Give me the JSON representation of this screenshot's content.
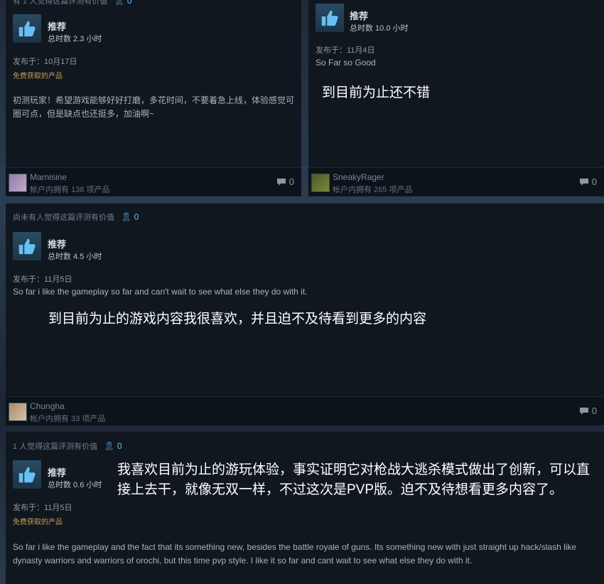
{
  "reviews": [
    {
      "helpful": "有 1 人觉得这篇评测有价值",
      "award_count": "0",
      "recommended": "推荐",
      "hours": "总时数 2.3 小时",
      "posted": "发布于：10月17日",
      "free": "免费获取的产品",
      "body": "初测玩家！希望游戏能够好好打磨，多花时间，不要着急上线，体验感觉可圈可点，但是缺点也还挺多，加油啊~",
      "user": "Marnisine",
      "products": "帐户内拥有 138 项产品",
      "comments": "0"
    },
    {
      "recommended": "推荐",
      "hours": "总时数 10.0 小时",
      "posted": "发布于：11月4日",
      "body": "So Far so Good",
      "overlay": "到目前为止还不错",
      "user": "SneakyRager",
      "products": "帐户内拥有 265 项产品",
      "comments": "0"
    },
    {
      "helpful": "尚未有人觉得这篇评测有价值",
      "award_count": "0",
      "recommended": "推荐",
      "hours": "总时数 4.5 小时",
      "posted": "发布于：11月5日",
      "body": "So far i like the gameplay so far and can't wait to see what else they do with it.",
      "overlay": "到目前为止的游戏内容我很喜欢，并且迫不及待看到更多的内容",
      "user": "Chungha",
      "products": "帐户内拥有 33 项产品",
      "comments": "0"
    },
    {
      "helpful": "1 人觉得这篇评测有价值",
      "award_count": "0",
      "recommended": "推荐",
      "hours": "总时数 0.6 小时",
      "posted": "发布于：11月5日",
      "free": "免费获取的产品",
      "body": "So far i like the gameplay and the fact that its something new, besides the battle royale of guns. Its something new with just straight up hack/slash like dynasty warriors and warriors of orochi, but this time pvp style. I like it so far and cant wait to see what else they do with it.",
      "overlay": "我喜欢目前为止的游玩体验，事实证明它对枪战大逃杀模式做出了创新，可以直接上去干，就像无双一样，不过这次是PVP版。迫不及待想看更多内容了。"
    }
  ],
  "colors": {
    "accent": "#66c0f4",
    "free": "#c59d58",
    "card": "#10171f"
  }
}
